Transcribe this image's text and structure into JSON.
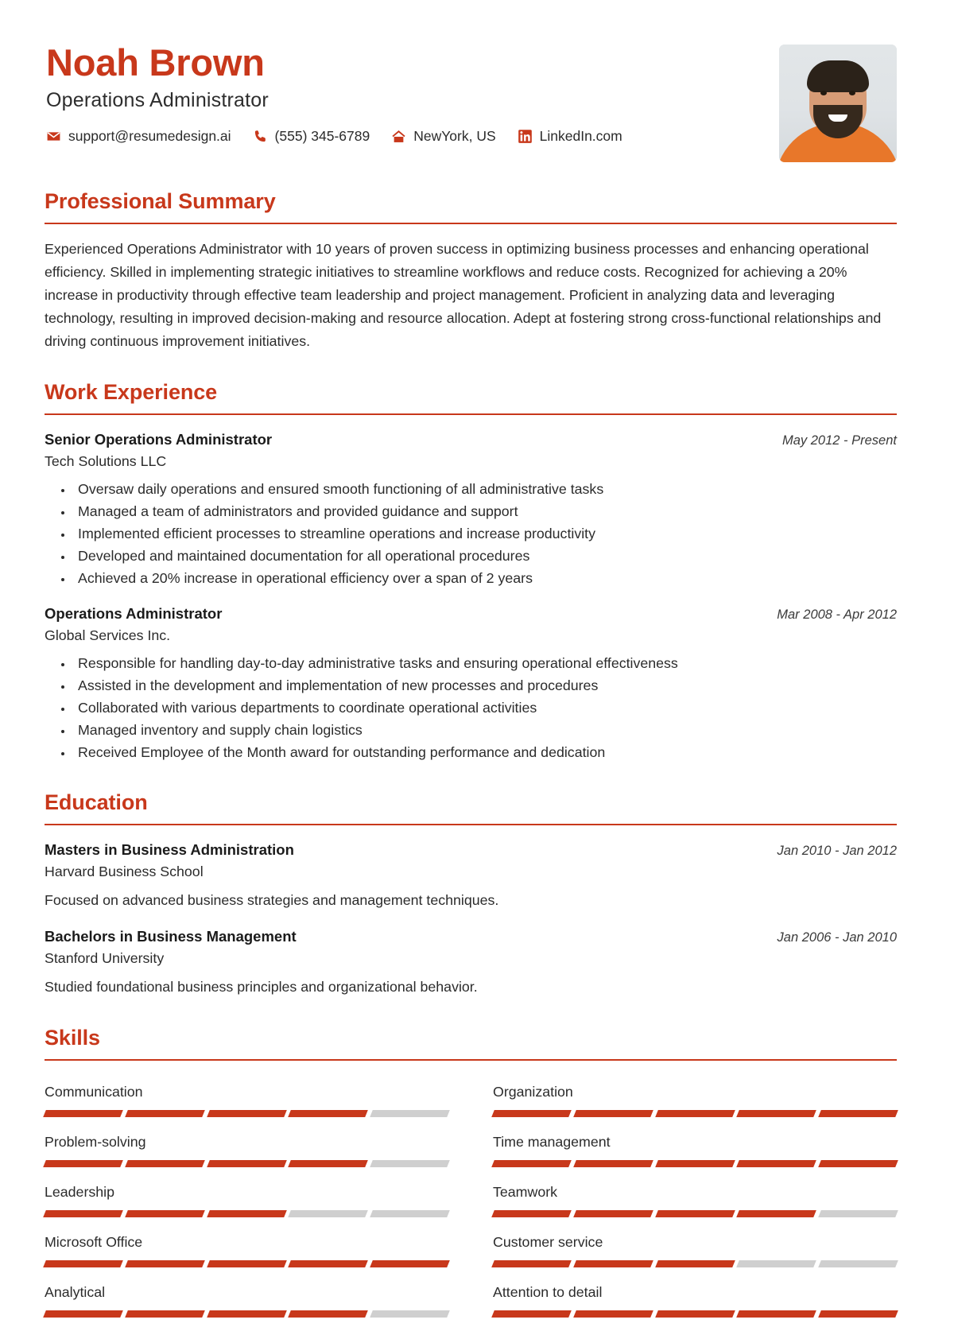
{
  "colors": {
    "accent": "#c8381b",
    "text": "#2b2b2b",
    "skill_empty": "#cfcfcf"
  },
  "header": {
    "name": "Noah Brown",
    "job_title": "Operations Administrator",
    "avatar_alt": "profile-photo",
    "contacts": [
      {
        "icon": "envelope-icon",
        "value": "support@resumedesign.ai"
      },
      {
        "icon": "phone-icon",
        "value": "(555) 345-6789"
      },
      {
        "icon": "home-icon",
        "value": "NewYork, US"
      },
      {
        "icon": "linkedin-icon",
        "value": "LinkedIn.com"
      }
    ]
  },
  "summary": {
    "title": "Professional Summary",
    "text": "Experienced Operations Administrator with 10 years of proven success in optimizing business processes and enhancing operational efficiency. Skilled in implementing strategic initiatives to streamline workflows and reduce costs. Recognized for achieving a 20% increase in productivity through effective team leadership and project management. Proficient in analyzing data and leveraging technology, resulting in improved decision-making and resource allocation. Adept at fostering strong cross-functional relationships and driving continuous improvement initiatives."
  },
  "work_experience": {
    "title": "Work Experience",
    "entries": [
      {
        "role": "Senior Operations Administrator",
        "org": "Tech Solutions LLC",
        "dates": "May 2012 - Present",
        "bullets": [
          "Oversaw daily operations and ensured smooth functioning of all administrative tasks",
          "Managed a team of administrators and provided guidance and support",
          "Implemented efficient processes to streamline operations and increase productivity",
          "Developed and maintained documentation for all operational procedures",
          "Achieved a 20% increase in operational efficiency over a span of 2 years"
        ]
      },
      {
        "role": "Operations Administrator",
        "org": "Global Services Inc.",
        "dates": "Mar 2008 - Apr 2012",
        "bullets": [
          "Responsible for handling day-to-day administrative tasks and ensuring operational effectiveness",
          "Assisted in the development and implementation of new processes and procedures",
          "Collaborated with various departments to coordinate operational activities",
          "Managed inventory and supply chain logistics",
          "Received Employee of the Month award for outstanding performance and dedication"
        ]
      }
    ]
  },
  "education": {
    "title": "Education",
    "entries": [
      {
        "degree": "Masters in Business Administration",
        "school": "Harvard Business School",
        "dates": "Jan 2010 - Jan 2012",
        "description": "Focused on advanced business strategies and management techniques."
      },
      {
        "degree": "Bachelors in Business Management",
        "school": "Stanford University",
        "dates": "Jan 2006 - Jan 2010",
        "description": "Studied foundational business principles and organizational behavior."
      }
    ]
  },
  "skills": {
    "title": "Skills",
    "max_level": 5,
    "items": [
      {
        "name": "Communication",
        "level": 4,
        "column": "left"
      },
      {
        "name": "Organization",
        "level": 5,
        "column": "right"
      },
      {
        "name": "Problem-solving",
        "level": 4,
        "column": "left"
      },
      {
        "name": "Time management",
        "level": 5,
        "column": "right"
      },
      {
        "name": "Leadership",
        "level": 3,
        "column": "left"
      },
      {
        "name": "Teamwork",
        "level": 4,
        "column": "right"
      },
      {
        "name": "Microsoft Office",
        "level": 5,
        "column": "left"
      },
      {
        "name": "Customer service",
        "level": 3,
        "column": "right"
      },
      {
        "name": "Analytical",
        "level": 4,
        "column": "left"
      },
      {
        "name": "Attention to detail",
        "level": 5,
        "column": "right"
      }
    ]
  }
}
